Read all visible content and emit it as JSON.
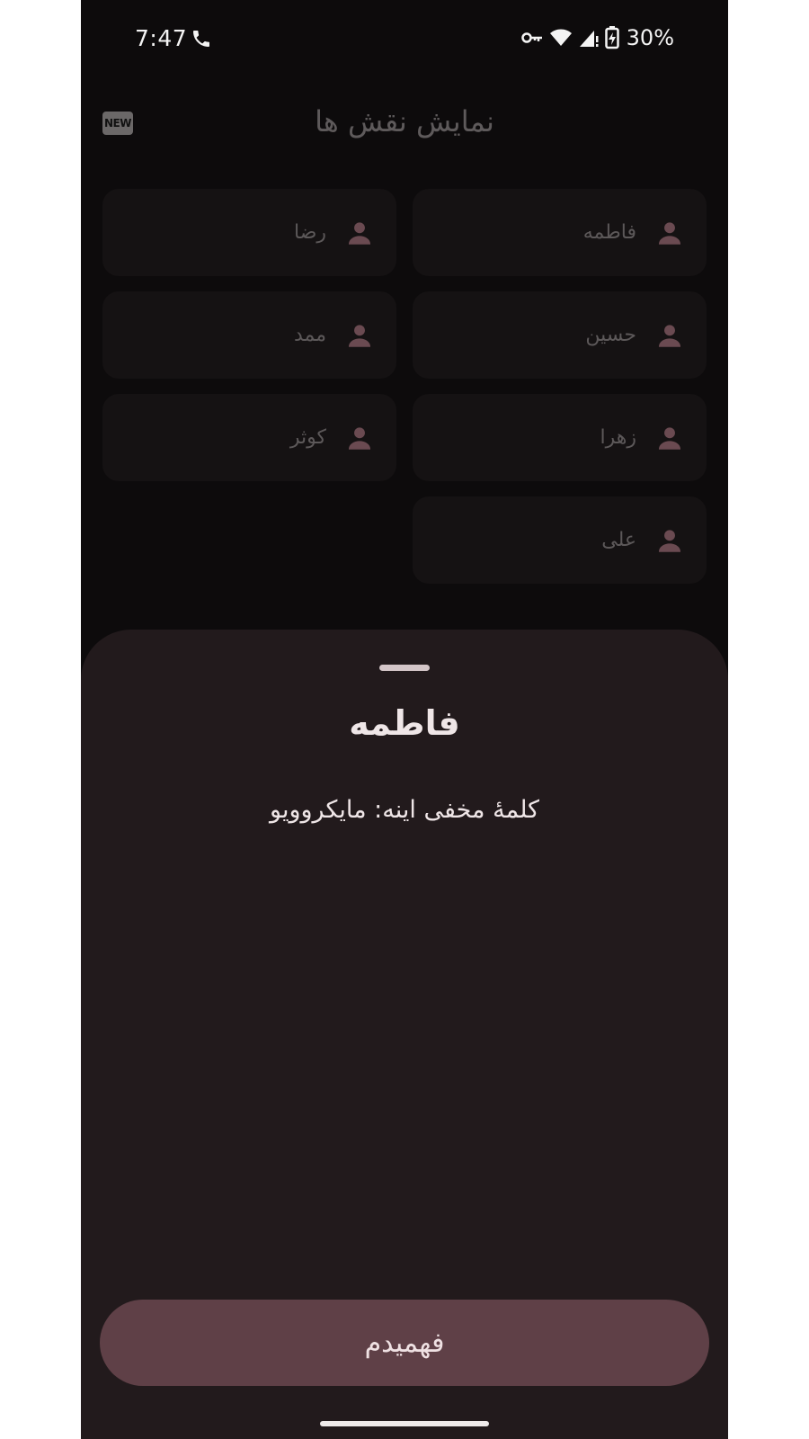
{
  "status_bar": {
    "time": "7:47",
    "battery": "30%",
    "icons": [
      "phone-icon",
      "vpn-key-icon",
      "wifi-icon",
      "cell-signal-icon",
      "battery-charging-icon"
    ]
  },
  "header": {
    "title": "نمایش نقش ها",
    "badge": "NEW"
  },
  "players": [
    {
      "name": "فاطمه",
      "icon": "person-icon"
    },
    {
      "name": "رضا",
      "icon": "person-icon"
    },
    {
      "name": "حسین",
      "icon": "person-icon"
    },
    {
      "name": "ممد",
      "icon": "person-icon"
    },
    {
      "name": "زهرا",
      "icon": "person-icon"
    },
    {
      "name": "کوثر",
      "icon": "person-icon"
    },
    {
      "name": "علی",
      "icon": "person-icon"
    }
  ],
  "sheet": {
    "title": "فاطمه",
    "message": "کلمۀ مخفی اینه: مایکروویو",
    "button_label": "فهمیدم"
  },
  "colors": {
    "background": "#0d0b0c",
    "card": "#151213",
    "sheet": "#221a1c",
    "button": "#5f4047",
    "avatar": "#8a5c66"
  }
}
